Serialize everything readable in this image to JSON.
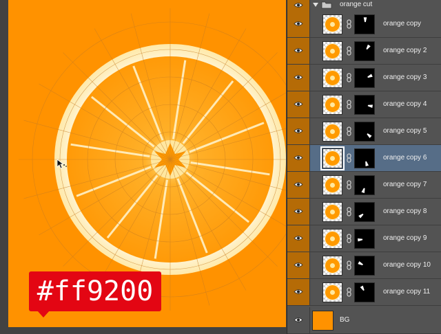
{
  "canvas": {
    "background_color": "#ff9200",
    "callout_text": "#ff9200",
    "callout_color": "#e30613",
    "cursor_icon": "move-cursor-icon"
  },
  "layers_panel": {
    "group": {
      "name": "orange cut",
      "expanded": true,
      "icon": "folder-icon"
    },
    "layers": [
      {
        "name": "orange copy",
        "visible": true,
        "active": false
      },
      {
        "name": "orange copy 2",
        "visible": true,
        "active": false
      },
      {
        "name": "orange copy 3",
        "visible": true,
        "active": false
      },
      {
        "name": "orange copy 4",
        "visible": true,
        "active": false
      },
      {
        "name": "orange copy 5",
        "visible": true,
        "active": false
      },
      {
        "name": "orange copy 6",
        "visible": true,
        "active": true
      },
      {
        "name": "orange copy 7",
        "visible": true,
        "active": false
      },
      {
        "name": "orange copy 8",
        "visible": true,
        "active": false
      },
      {
        "name": "orange copy 9",
        "visible": true,
        "active": false
      },
      {
        "name": "orange copy 10",
        "visible": true,
        "active": false
      },
      {
        "name": "orange copy 11",
        "visible": true,
        "active": false
      }
    ],
    "background_layer": {
      "name": "BG",
      "color": "#ff9200",
      "visible": true
    },
    "visibility_color": "#b56b06",
    "active_color": "#566d87"
  }
}
